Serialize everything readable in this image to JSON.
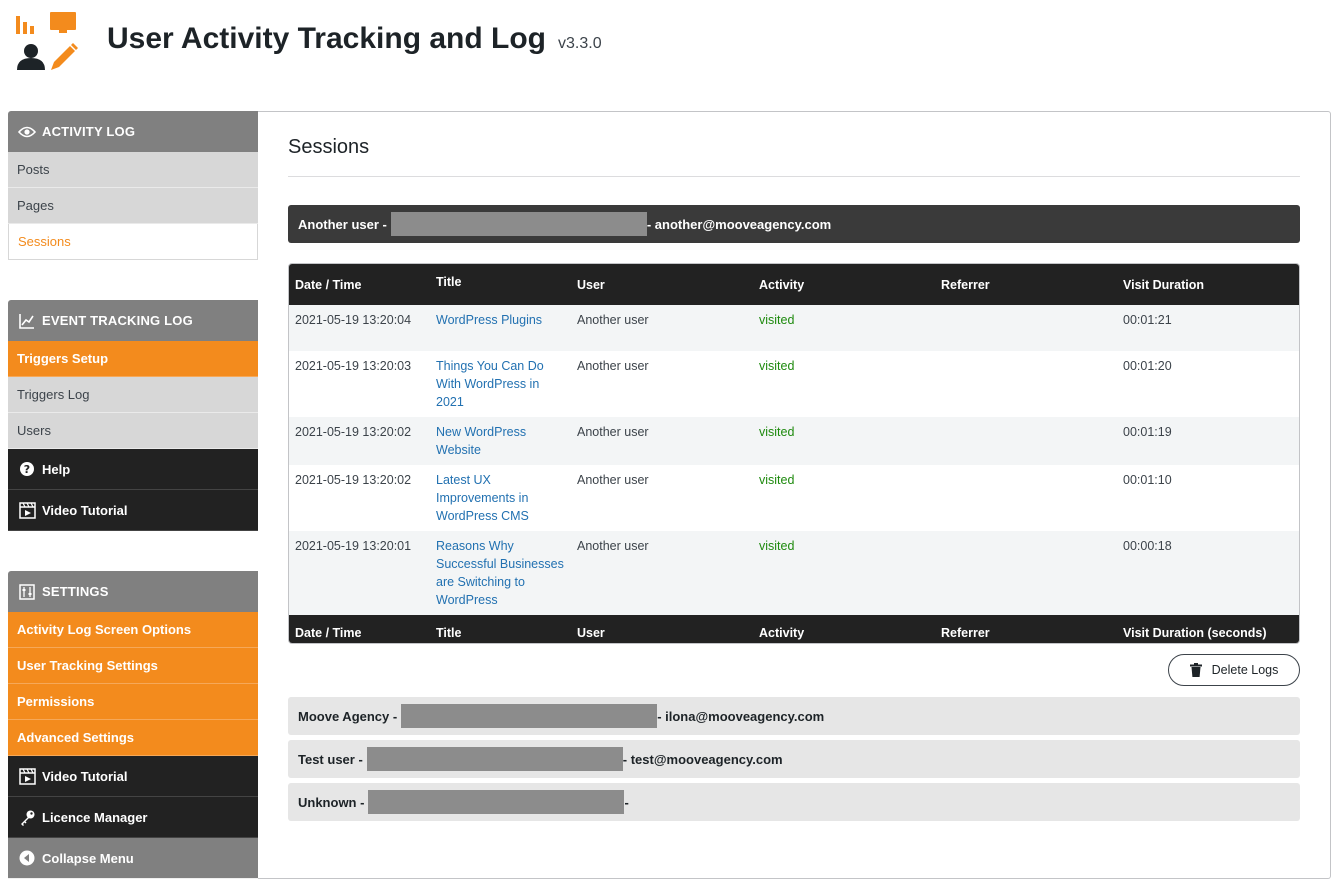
{
  "header": {
    "title": "User Activity Tracking and Log",
    "version": "v3.3.0"
  },
  "sidebar": {
    "activity_log": {
      "heading": "ACTIVITY LOG",
      "items": [
        "Posts",
        "Pages",
        "Sessions"
      ],
      "active": "Sessions"
    },
    "event_tracking": {
      "heading": "EVENT TRACKING LOG",
      "items": [
        "Triggers Setup",
        "Triggers Log",
        "Users"
      ],
      "help": "Help",
      "video_tutorial": "Video Tutorial"
    },
    "settings": {
      "heading": "SETTINGS",
      "items": [
        "Activity Log Screen Options",
        "User Tracking Settings",
        "Permissions",
        "Advanced Settings"
      ],
      "video_tutorial": "Video Tutorial",
      "licence_manager": "Licence Manager",
      "collapse_menu": "Collapse Menu"
    }
  },
  "main": {
    "title": "Sessions",
    "expanded_user": {
      "name": "Another user -",
      "email": "- another@mooveagency.com"
    },
    "table": {
      "headers": [
        "Date / Time",
        "Title",
        "User",
        "Activity",
        "Referrer",
        "Visit Duration"
      ],
      "footers": [
        "Date / Time",
        "Title",
        "User",
        "Activity",
        "Referrer",
        "Visit Duration (seconds)"
      ],
      "rows": [
        {
          "date": "2021-05-19 13:20:04",
          "title": "WordPress Plugins",
          "user": "Another user",
          "activity": "visited",
          "referrer": "",
          "duration": "00:01:21"
        },
        {
          "date": "2021-05-19 13:20:03",
          "title": "Things You Can Do With WordPress in 2021",
          "user": "Another user",
          "activity": "visited",
          "referrer": "",
          "duration": "00:01:20"
        },
        {
          "date": "2021-05-19 13:20:02",
          "title": "New WordPress Website",
          "user": "Another user",
          "activity": "visited",
          "referrer": "",
          "duration": "00:01:19"
        },
        {
          "date": "2021-05-19 13:20:02",
          "title": "Latest UX Improvements in WordPress CMS",
          "user": "Another user",
          "activity": "visited",
          "referrer": "",
          "duration": "00:01:10"
        },
        {
          "date": "2021-05-19 13:20:01",
          "title": "Reasons Why Successful Businesses are Switching to WordPress",
          "user": "Another user",
          "activity": "visited",
          "referrer": "",
          "duration": "00:00:18"
        }
      ]
    },
    "delete_button": "Delete Logs",
    "other_users": [
      {
        "name": "Moove Agency -",
        "email": "- ilona@mooveagency.com"
      },
      {
        "name": "Test user -",
        "email": "- test@mooveagency.com"
      },
      {
        "name": "Unknown -",
        "email": "-"
      }
    ]
  },
  "colors": {
    "accent": "#f38b1d",
    "dark": "#222222",
    "grey": "#808080",
    "link": "#2271b1",
    "visited": "#1e8a0e"
  }
}
